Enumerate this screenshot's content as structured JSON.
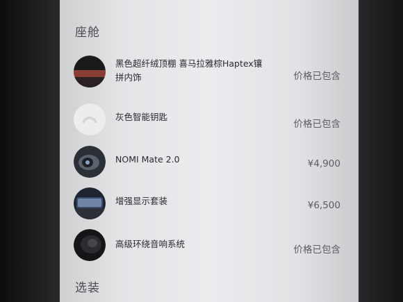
{
  "sections": {
    "cabin_title": "座舱",
    "options_title": "选装"
  },
  "items": [
    {
      "name": "黑色超纤绒顶棚 喜马拉雅棕Haptex镶拼内饰",
      "price": "价格已包含",
      "thumb_icon": "interior-trim-swatch"
    },
    {
      "name": "灰色智能钥匙",
      "price": "价格已包含",
      "thumb_icon": "smart-key"
    },
    {
      "name": "NOMI Mate 2.0",
      "price": "¥4,900",
      "thumb_icon": "nomi-mate-device"
    },
    {
      "name": "增强显示套装",
      "price": "¥6,500",
      "thumb_icon": "display-screen"
    },
    {
      "name": "高级环绕音响系统",
      "price": "价格已包含",
      "thumb_icon": "speaker"
    }
  ],
  "colors": {
    "screen_bg": "#e6e6e9",
    "bezel": "#1b1b1d",
    "text_primary": "#2a2a2e",
    "text_secondary": "#5c5c60"
  }
}
